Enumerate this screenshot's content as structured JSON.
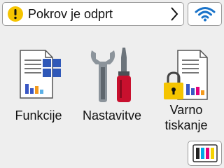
{
  "status": {
    "message": "Pokrov je odprt",
    "icon": "warning-icon",
    "icon_color": "#f5c400"
  },
  "wifi": {
    "icon": "wifi-icon",
    "color": "#1a73c9"
  },
  "tiles": [
    {
      "label": "Funkcije",
      "icon": "functions-icon"
    },
    {
      "label": "Nastavitve",
      "icon": "settings-tools-icon"
    },
    {
      "label_line1": "Varno",
      "label_line2": "tiskanje",
      "icon": "secure-print-icon"
    }
  ],
  "ink": {
    "icon": "ink-cartridges-icon",
    "colors": [
      "#222222",
      "#00a6e6",
      "#e2007a",
      "#f5d200"
    ]
  }
}
